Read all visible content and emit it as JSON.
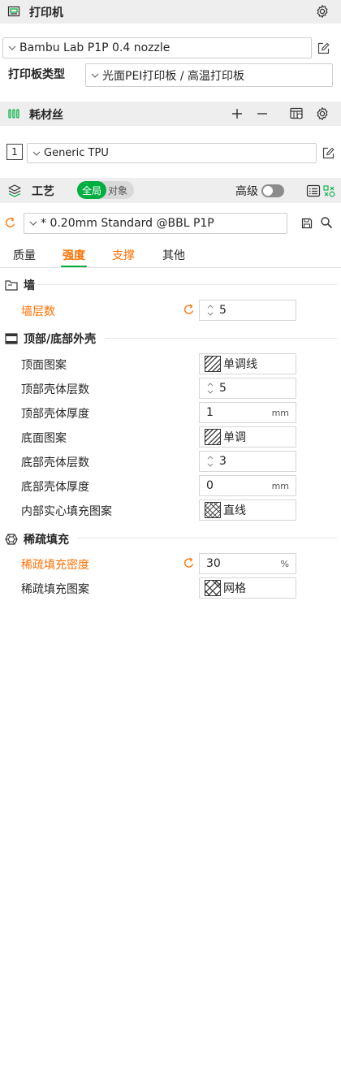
{
  "printer": {
    "title": "打印机",
    "preset": "Bambu Lab P1P 0.4 nozzle",
    "plate_label": "打印板类型",
    "plate_value": "光面PEI打印板 / 高温打印板"
  },
  "filament": {
    "title": "耗材丝",
    "slot_number": "1",
    "preset": "Generic TPU"
  },
  "process": {
    "title": "工艺",
    "toggle_global": "全局",
    "toggle_object": "对象",
    "advanced_label": "高级",
    "preset": "* 0.20mm Standard @BBL P1P"
  },
  "tabs": [
    {
      "label": "质量"
    },
    {
      "label": "强度"
    },
    {
      "label": "支撑"
    },
    {
      "label": "其他"
    }
  ],
  "groups": {
    "wall": {
      "title": "墙",
      "wall_loops": {
        "label": "墙层数",
        "value": "5"
      }
    },
    "shell": {
      "title": "顶部/底部外壳",
      "top_pattern": {
        "label": "顶面图案",
        "value": "单调线"
      },
      "top_layers": {
        "label": "顶部壳体层数",
        "value": "5"
      },
      "top_thickness": {
        "label": "顶部壳体厚度",
        "value": "1",
        "unit": "mm"
      },
      "bottom_pattern": {
        "label": "底面图案",
        "value": "单调"
      },
      "bottom_layers": {
        "label": "底部壳体层数",
        "value": "3"
      },
      "bottom_thickness": {
        "label": "底部壳体厚度",
        "value": "0",
        "unit": "mm"
      },
      "internal_pattern": {
        "label": "内部实心填充图案",
        "value": "直线"
      }
    },
    "infill": {
      "title": "稀疏填充",
      "density": {
        "label": "稀疏填充密度",
        "value": "30",
        "unit": "%"
      },
      "pattern": {
        "label": "稀疏填充图案",
        "value": "网格"
      }
    }
  },
  "colors": {
    "accent_green": "#00ae42",
    "modified_orange": "#ff6f00",
    "header_bg": "#eeeeee"
  }
}
